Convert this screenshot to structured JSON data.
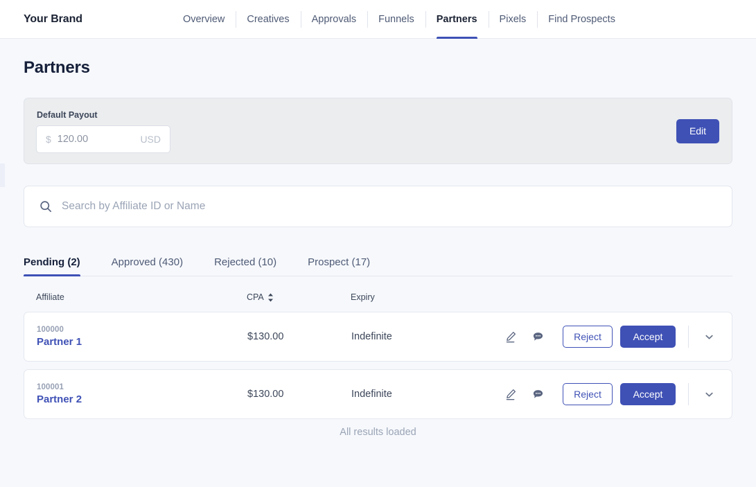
{
  "header": {
    "brand": "Your Brand",
    "nav": [
      {
        "label": "Overview",
        "active": false
      },
      {
        "label": "Creatives",
        "active": false
      },
      {
        "label": "Approvals",
        "active": false
      },
      {
        "label": "Funnels",
        "active": false
      },
      {
        "label": "Partners",
        "active": true
      },
      {
        "label": "Pixels",
        "active": false
      },
      {
        "label": "Find Prospects",
        "active": false
      }
    ]
  },
  "page": {
    "title": "Partners"
  },
  "payout": {
    "label": "Default Payout",
    "currency_sign": "$",
    "value": "120.00",
    "currency_code": "USD",
    "edit_label": "Edit"
  },
  "search": {
    "placeholder": "Search by Affiliate ID or Name",
    "value": "",
    "icon": "search-icon"
  },
  "tabs": [
    {
      "label": "Pending (2)",
      "active": true
    },
    {
      "label": "Approved (430)",
      "active": false
    },
    {
      "label": "Rejected (10)",
      "active": false
    },
    {
      "label": "Prospect (17)",
      "active": false
    }
  ],
  "table": {
    "columns": {
      "affiliate": "Affiliate",
      "cpa": "CPA",
      "expiry": "Expiry"
    },
    "sort_icon": "sort-updown-icon",
    "rows": [
      {
        "affiliate_id": "100000",
        "affiliate_name": "Partner 1",
        "cpa": "$130.00",
        "expiry": "Indefinite",
        "reject_label": "Reject",
        "accept_label": "Accept",
        "pencil_icon": "pencil-edit-icon",
        "chat_icon": "chat-bubble-icon",
        "expand_icon": "chevron-down-icon"
      },
      {
        "affiliate_id": "100001",
        "affiliate_name": "Partner 2",
        "cpa": "$130.00",
        "expiry": "Indefinite",
        "reject_label": "Reject",
        "accept_label": "Accept",
        "pencil_icon": "pencil-edit-icon",
        "chat_icon": "chat-bubble-icon",
        "expand_icon": "chevron-down-icon"
      }
    ]
  },
  "footer": {
    "results_status": "All results loaded"
  },
  "colors": {
    "accent": "#3f51b5",
    "page_bg": "#f6f8fc",
    "card_bg": "#ebedef",
    "text_primary": "#16203a",
    "text_muted": "#9aa4b5"
  }
}
